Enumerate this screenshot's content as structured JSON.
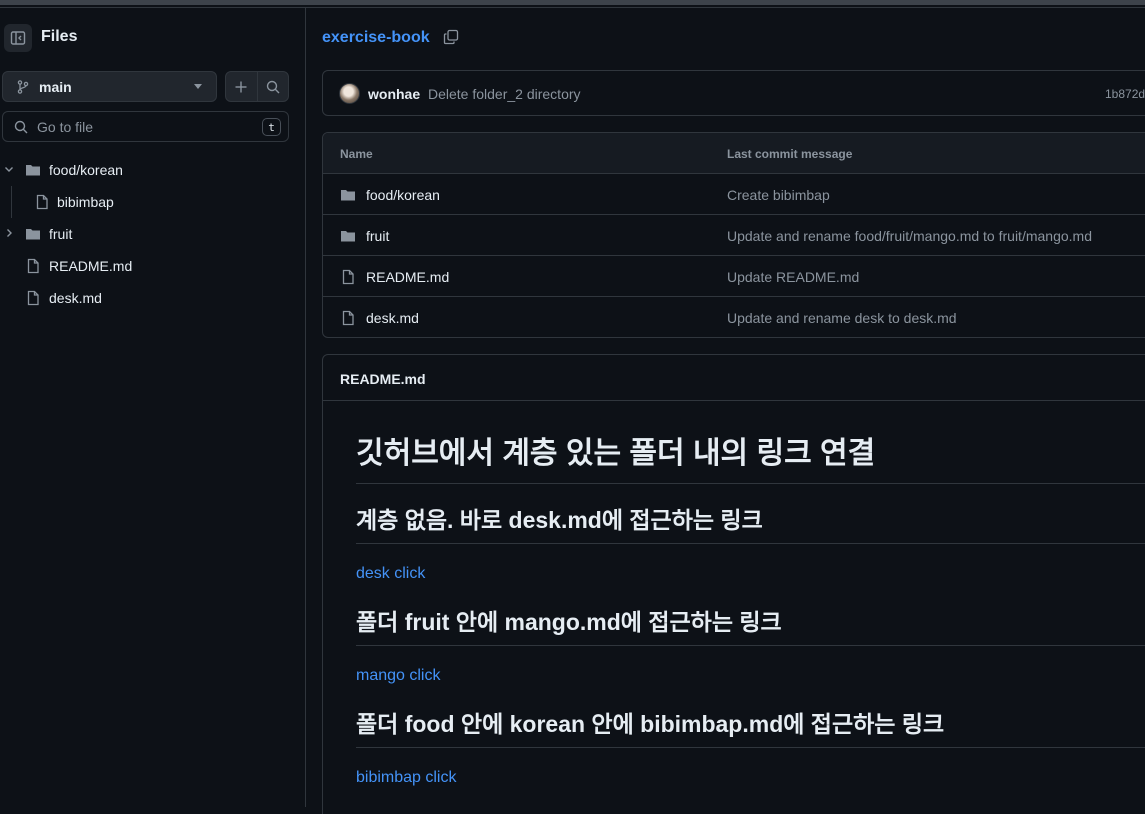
{
  "sidebar": {
    "title": "Files",
    "branch": "main",
    "search_placeholder": "Go to file",
    "search_shortcut": "t",
    "tree": [
      {
        "name": "food/korean",
        "type": "folder",
        "expanded": true,
        "depth": 0
      },
      {
        "name": "bibimbap",
        "type": "file",
        "depth": 1
      },
      {
        "name": "fruit",
        "type": "folder",
        "expanded": false,
        "depth": 0
      },
      {
        "name": "README.md",
        "type": "file",
        "depth": 0
      },
      {
        "name": "desk.md",
        "type": "file",
        "depth": 0
      }
    ]
  },
  "breadcrumb": {
    "repo": "exercise-book"
  },
  "commit": {
    "author": "wonhae",
    "message": "Delete folder_2 directory",
    "sha": "1b872d"
  },
  "files": {
    "col_name": "Name",
    "col_message": "Last commit message",
    "rows": [
      {
        "name": "food/korean",
        "type": "folder",
        "message": "Create bibimbap"
      },
      {
        "name": "fruit",
        "type": "folder",
        "message": "Update and rename food/fruit/mango.md to fruit/mango.md"
      },
      {
        "name": "README.md",
        "type": "file",
        "message": "Update README.md"
      },
      {
        "name": "desk.md",
        "type": "file",
        "message": "Update and rename desk to desk.md"
      }
    ]
  },
  "readme": {
    "header": "README.md",
    "h1": "깃허브에서 계층 있는 폴더 내의 링크 연결",
    "sections": [
      {
        "heading": "계층 없음. 바로 desk.md에 접근하는 링크",
        "link": "desk click"
      },
      {
        "heading": "폴더 fruit 안에 mango.md에 접근하는 링크",
        "link": "mango click"
      },
      {
        "heading": "폴더 food 안에 korean 안에 bibimbap.md에 접근하는 링크",
        "link": "bibimbap click"
      }
    ]
  },
  "colors": {
    "bg": "#0d1117",
    "border": "#30363d",
    "link": "#4493f8",
    "muted": "#8b949e",
    "text": "#e6edf3"
  }
}
